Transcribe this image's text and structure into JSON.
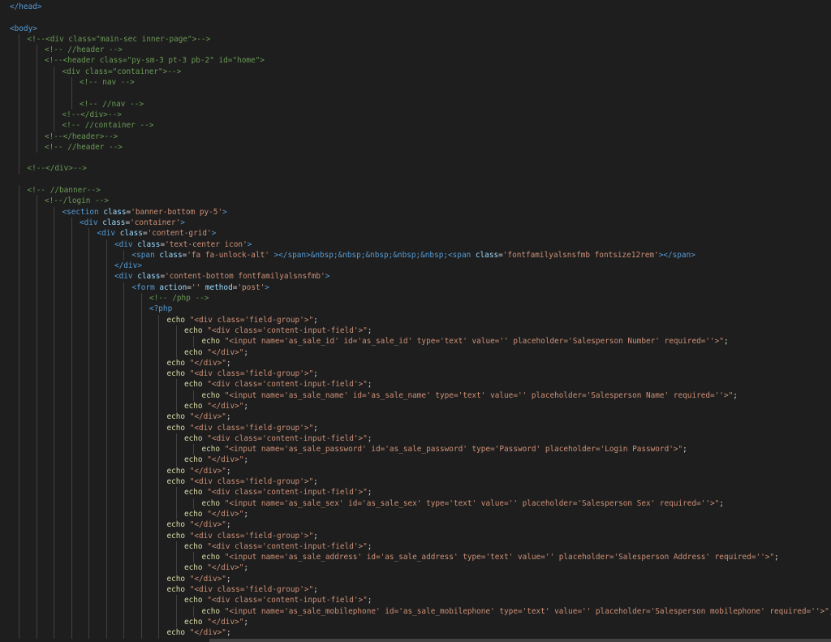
{
  "editor": {
    "colors": {
      "background": "#1e1e1e",
      "tag": "#569cd6",
      "attribute": "#9cdcfe",
      "string": "#ce9178",
      "comment": "#6a9955",
      "text": "#d4d4d4",
      "function": "#dcdcaa"
    },
    "lines": [
      [
        {
          "k": "t",
          "v": "</head>"
        }
      ],
      [],
      [
        {
          "k": "t",
          "v": "<body>"
        }
      ],
      [
        {
          "k": "c",
          "v": "<!--<div class=\"main-sec inner-page\">-->"
        }
      ],
      [
        {
          "k": "c",
          "v": "<!-- //header -->"
        }
      ],
      [
        {
          "k": "c",
          "v": "<!--<header class=\"py-sm-3 pt-3 pb-2\" id=\"home\">"
        }
      ],
      [
        {
          "k": "c",
          "v": "<div class=\"container\">-->"
        }
      ],
      [
        {
          "k": "c",
          "v": "<!-- nav -->"
        }
      ],
      [],
      [
        {
          "k": "c",
          "v": "<!-- //nav -->"
        }
      ],
      [
        {
          "k": "c",
          "v": "<!--</div>-->"
        }
      ],
      [
        {
          "k": "c",
          "v": "<!-- //container -->"
        }
      ],
      [
        {
          "k": "c",
          "v": "<!--</header>-->"
        }
      ],
      [
        {
          "k": "c",
          "v": "<!-- //header -->"
        }
      ],
      [],
      [
        {
          "k": "c",
          "v": "<!--</div>-->"
        }
      ],
      [],
      [
        {
          "k": "c",
          "v": "<!-- //banner-->"
        }
      ],
      [
        {
          "k": "c",
          "v": "<!--/login -->"
        }
      ],
      [
        {
          "k": "t",
          "v": "<section "
        },
        {
          "k": "a",
          "v": "class"
        },
        {
          "k": "p",
          "v": "="
        },
        {
          "k": "s",
          "v": "'banner-bottom py-5'"
        },
        {
          "k": "t",
          "v": ">"
        }
      ],
      [
        {
          "k": "t",
          "v": "<div "
        },
        {
          "k": "a",
          "v": "class"
        },
        {
          "k": "p",
          "v": "="
        },
        {
          "k": "s",
          "v": "'container'"
        },
        {
          "k": "t",
          "v": ">"
        }
      ],
      [
        {
          "k": "t",
          "v": "<div "
        },
        {
          "k": "a",
          "v": "class"
        },
        {
          "k": "p",
          "v": "="
        },
        {
          "k": "s",
          "v": "'content-grid'"
        },
        {
          "k": "t",
          "v": ">"
        }
      ],
      [
        {
          "k": "t",
          "v": "<div "
        },
        {
          "k": "a",
          "v": "class"
        },
        {
          "k": "p",
          "v": "="
        },
        {
          "k": "s",
          "v": "'text-center icon'"
        },
        {
          "k": "t",
          "v": ">"
        }
      ],
      [
        {
          "k": "t",
          "v": "<span "
        },
        {
          "k": "a",
          "v": "class"
        },
        {
          "k": "p",
          "v": "="
        },
        {
          "k": "s",
          "v": "'fa fa-unlock-alt'"
        },
        {
          "k": "t",
          "v": " ></span>"
        },
        {
          "k": "e",
          "v": "&nbsp;&nbsp;&nbsp;&nbsp;&nbsp;"
        },
        {
          "k": "t",
          "v": "<span "
        },
        {
          "k": "a",
          "v": "class"
        },
        {
          "k": "p",
          "v": "="
        },
        {
          "k": "s",
          "v": "'fontfamilyalsnsfmb fontsize12rem'"
        },
        {
          "k": "t",
          "v": "></span>"
        }
      ],
      [
        {
          "k": "t",
          "v": "</div>"
        }
      ],
      [
        {
          "k": "t",
          "v": "<div "
        },
        {
          "k": "a",
          "v": "class"
        },
        {
          "k": "p",
          "v": "="
        },
        {
          "k": "s",
          "v": "'content-bottom fontfamilyalsnsfmb'"
        },
        {
          "k": "t",
          "v": ">"
        }
      ],
      [
        {
          "k": "t",
          "v": "<form "
        },
        {
          "k": "a",
          "v": "action"
        },
        {
          "k": "p",
          "v": "="
        },
        {
          "k": "s",
          "v": "''"
        },
        {
          "k": "p",
          "v": " "
        },
        {
          "k": "a",
          "v": "method"
        },
        {
          "k": "p",
          "v": "="
        },
        {
          "k": "s",
          "v": "'post'"
        },
        {
          "k": "t",
          "v": ">"
        }
      ],
      [
        {
          "k": "c",
          "v": "<!-- /php -->"
        }
      ],
      [
        {
          "k": "h",
          "v": "<?php"
        }
      ],
      [
        {
          "k": "k",
          "v": "echo"
        },
        {
          "k": "p",
          "v": " "
        },
        {
          "k": "s",
          "v": "\"<div class='field-group'>\""
        },
        {
          "k": "p",
          "v": ";"
        }
      ],
      [
        {
          "k": "k",
          "v": "echo"
        },
        {
          "k": "p",
          "v": " "
        },
        {
          "k": "s",
          "v": "\"<div class='content-input-field'>\""
        },
        {
          "k": "p",
          "v": ";"
        }
      ],
      [
        {
          "k": "k",
          "v": "echo"
        },
        {
          "k": "p",
          "v": " "
        },
        {
          "k": "s",
          "v": "\"<input name='as_sale_id' id='as_sale_id' type='text' value='' placeholder='Salesperson Number' required=''>\""
        },
        {
          "k": "p",
          "v": ";"
        }
      ],
      [
        {
          "k": "k",
          "v": "echo"
        },
        {
          "k": "p",
          "v": " "
        },
        {
          "k": "s",
          "v": "\"</div>\""
        },
        {
          "k": "p",
          "v": ";"
        }
      ],
      [
        {
          "k": "k",
          "v": "echo"
        },
        {
          "k": "p",
          "v": " "
        },
        {
          "k": "s",
          "v": "\"</div>\""
        },
        {
          "k": "p",
          "v": ";"
        }
      ],
      [
        {
          "k": "k",
          "v": "echo"
        },
        {
          "k": "p",
          "v": " "
        },
        {
          "k": "s",
          "v": "\"<div class='field-group'>\""
        },
        {
          "k": "p",
          "v": ";"
        }
      ],
      [
        {
          "k": "k",
          "v": "echo"
        },
        {
          "k": "p",
          "v": " "
        },
        {
          "k": "s",
          "v": "\"<div class='content-input-field'>\""
        },
        {
          "k": "p",
          "v": ";"
        }
      ],
      [
        {
          "k": "k",
          "v": "echo"
        },
        {
          "k": "p",
          "v": " "
        },
        {
          "k": "s",
          "v": "\"<input name='as_sale_name' id='as_sale_name' type='text' value='' placeholder='Salesperson Name' required=''>\""
        },
        {
          "k": "p",
          "v": ";"
        }
      ],
      [
        {
          "k": "k",
          "v": "echo"
        },
        {
          "k": "p",
          "v": " "
        },
        {
          "k": "s",
          "v": "\"</div>\""
        },
        {
          "k": "p",
          "v": ";"
        }
      ],
      [
        {
          "k": "k",
          "v": "echo"
        },
        {
          "k": "p",
          "v": " "
        },
        {
          "k": "s",
          "v": "\"</div>\""
        },
        {
          "k": "p",
          "v": ";"
        }
      ],
      [
        {
          "k": "k",
          "v": "echo"
        },
        {
          "k": "p",
          "v": " "
        },
        {
          "k": "s",
          "v": "\"<div class='field-group'>\""
        },
        {
          "k": "p",
          "v": ";"
        }
      ],
      [
        {
          "k": "k",
          "v": "echo"
        },
        {
          "k": "p",
          "v": " "
        },
        {
          "k": "s",
          "v": "\"<div class='content-input-field'>\""
        },
        {
          "k": "p",
          "v": ";"
        }
      ],
      [
        {
          "k": "k",
          "v": "echo"
        },
        {
          "k": "p",
          "v": " "
        },
        {
          "k": "s",
          "v": "\"<input name='as_sale_password' id='as_sale_password' type='Password' placeholder='Login Password'>\""
        },
        {
          "k": "p",
          "v": ";"
        }
      ],
      [
        {
          "k": "k",
          "v": "echo"
        },
        {
          "k": "p",
          "v": " "
        },
        {
          "k": "s",
          "v": "\"</div>\""
        },
        {
          "k": "p",
          "v": ";"
        }
      ],
      [
        {
          "k": "k",
          "v": "echo"
        },
        {
          "k": "p",
          "v": " "
        },
        {
          "k": "s",
          "v": "\"</div>\""
        },
        {
          "k": "p",
          "v": ";"
        }
      ],
      [
        {
          "k": "k",
          "v": "echo"
        },
        {
          "k": "p",
          "v": " "
        },
        {
          "k": "s",
          "v": "\"<div class='field-group'>\""
        },
        {
          "k": "p",
          "v": ";"
        }
      ],
      [
        {
          "k": "k",
          "v": "echo"
        },
        {
          "k": "p",
          "v": " "
        },
        {
          "k": "s",
          "v": "\"<div class='content-input-field'>\""
        },
        {
          "k": "p",
          "v": ";"
        }
      ],
      [
        {
          "k": "k",
          "v": "echo"
        },
        {
          "k": "p",
          "v": " "
        },
        {
          "k": "s",
          "v": "\"<input name='as_sale_sex' id='as_sale_sex' type='text' value='' placeholder='Salesperson Sex' required=''>\""
        },
        {
          "k": "p",
          "v": ";"
        }
      ],
      [
        {
          "k": "k",
          "v": "echo"
        },
        {
          "k": "p",
          "v": " "
        },
        {
          "k": "s",
          "v": "\"</div>\""
        },
        {
          "k": "p",
          "v": ";"
        }
      ],
      [
        {
          "k": "k",
          "v": "echo"
        },
        {
          "k": "p",
          "v": " "
        },
        {
          "k": "s",
          "v": "\"</div>\""
        },
        {
          "k": "p",
          "v": ";"
        }
      ],
      [
        {
          "k": "k",
          "v": "echo"
        },
        {
          "k": "p",
          "v": " "
        },
        {
          "k": "s",
          "v": "\"<div class='field-group'>\""
        },
        {
          "k": "p",
          "v": ";"
        }
      ],
      [
        {
          "k": "k",
          "v": "echo"
        },
        {
          "k": "p",
          "v": " "
        },
        {
          "k": "s",
          "v": "\"<div class='content-input-field'>\""
        },
        {
          "k": "p",
          "v": ";"
        }
      ],
      [
        {
          "k": "k",
          "v": "echo"
        },
        {
          "k": "p",
          "v": " "
        },
        {
          "k": "s",
          "v": "\"<input name='as_sale_address' id='as_sale_address' type='text' value='' placeholder='Salesperson Address' required=''>\""
        },
        {
          "k": "p",
          "v": ";"
        }
      ],
      [
        {
          "k": "k",
          "v": "echo"
        },
        {
          "k": "p",
          "v": " "
        },
        {
          "k": "s",
          "v": "\"</div>\""
        },
        {
          "k": "p",
          "v": ";"
        }
      ],
      [
        {
          "k": "k",
          "v": "echo"
        },
        {
          "k": "p",
          "v": " "
        },
        {
          "k": "s",
          "v": "\"</div>\""
        },
        {
          "k": "p",
          "v": ";"
        }
      ],
      [
        {
          "k": "k",
          "v": "echo"
        },
        {
          "k": "p",
          "v": " "
        },
        {
          "k": "s",
          "v": "\"<div class='field-group'>\""
        },
        {
          "k": "p",
          "v": ";"
        }
      ],
      [
        {
          "k": "k",
          "v": "echo"
        },
        {
          "k": "p",
          "v": " "
        },
        {
          "k": "s",
          "v": "\"<div class='content-input-field'>\""
        },
        {
          "k": "p",
          "v": ";"
        }
      ],
      [
        {
          "k": "k",
          "v": "echo"
        },
        {
          "k": "p",
          "v": " "
        },
        {
          "k": "s",
          "v": "\"<input name='as_sale_mobilephone' id='as_sale_mobilephone' type='text' value='' placeholder='Salesperson mobilephone' required=''>\""
        },
        {
          "k": "p",
          "v": ";"
        }
      ],
      [
        {
          "k": "k",
          "v": "echo"
        },
        {
          "k": "p",
          "v": " "
        },
        {
          "k": "s",
          "v": "\"</div>\""
        },
        {
          "k": "p",
          "v": ";"
        }
      ],
      [
        {
          "k": "k",
          "v": "echo"
        },
        {
          "k": "p",
          "v": " "
        },
        {
          "k": "s",
          "v": "\"</div>\""
        },
        {
          "k": "p",
          "v": ";"
        }
      ]
    ]
  }
}
